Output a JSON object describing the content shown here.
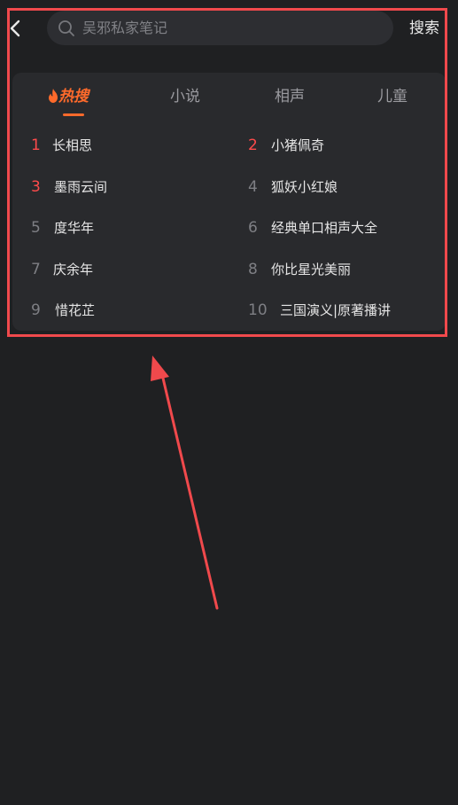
{
  "search": {
    "placeholder": "吴邪私家笔记",
    "submit_label": "搜索"
  },
  "tabs": [
    {
      "label": "热搜",
      "active": true
    },
    {
      "label": "小说",
      "active": false
    },
    {
      "label": "相声",
      "active": false
    },
    {
      "label": "儿童",
      "active": false
    }
  ],
  "hot_list": [
    {
      "rank": "1",
      "title": "长相思"
    },
    {
      "rank": "2",
      "title": "小猪佩奇"
    },
    {
      "rank": "3",
      "title": "墨雨云间"
    },
    {
      "rank": "4",
      "title": "狐妖小红娘"
    },
    {
      "rank": "5",
      "title": "度华年"
    },
    {
      "rank": "6",
      "title": "经典单口相声大全"
    },
    {
      "rank": "7",
      "title": "庆余年"
    },
    {
      "rank": "8",
      "title": "你比星光美丽"
    },
    {
      "rank": "9",
      "title": "惜花芷"
    },
    {
      "rank": "10",
      "title": "三国演义|原著播讲"
    }
  ],
  "colors": {
    "background": "#1f2022",
    "panel": "#292a2d",
    "accent": "#ff6a2b",
    "top_rank": "#ff4b4b",
    "annotation": "#f0494c"
  },
  "icons": {
    "back": "chevron-left-icon",
    "search": "search-icon",
    "hot": "flame-icon"
  }
}
